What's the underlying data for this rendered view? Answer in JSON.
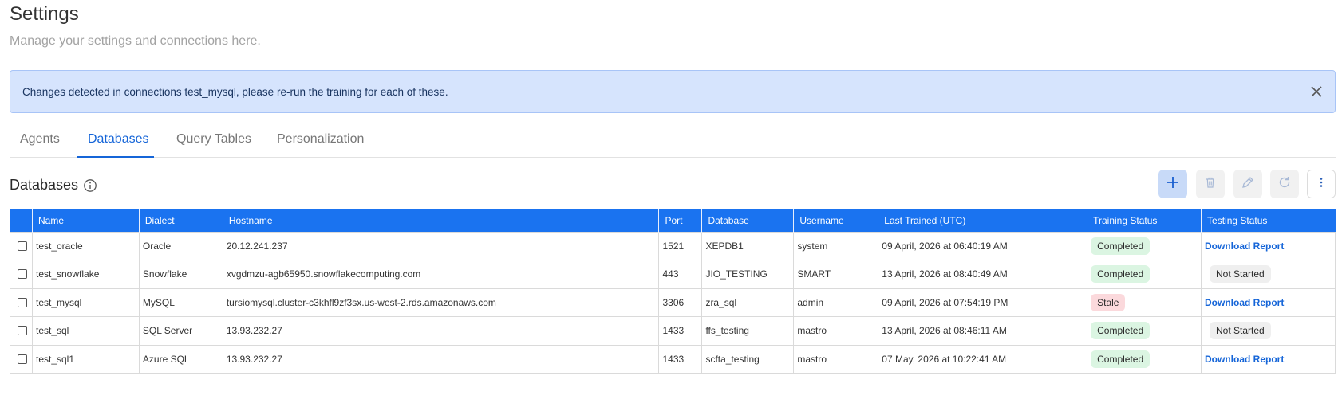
{
  "page": {
    "title": "Settings",
    "subtitle": "Manage your settings and connections here."
  },
  "alert": {
    "message": "Changes detected in connections test_mysql, please re-run the training for each of these."
  },
  "tabs": [
    {
      "label": "Agents"
    },
    {
      "label": "Databases"
    },
    {
      "label": "Query Tables"
    },
    {
      "label": "Personalization"
    }
  ],
  "section": {
    "title": "Databases"
  },
  "table": {
    "headers": [
      "Name",
      "Dialect",
      "Hostname",
      "Port",
      "Database",
      "Username",
      "Last Trained (UTC)",
      "Training Status",
      "Testing Status"
    ],
    "rows": [
      {
        "name": "test_oracle",
        "dialect": "Oracle",
        "hostname": "20.12.241.237",
        "port": "1521",
        "database": "XEPDB1",
        "username": "system",
        "last_trained": "09 April, 2026 at 06:40:19 AM",
        "training_status": "Completed",
        "testing_status": "Download Report"
      },
      {
        "name": "test_snowflake",
        "dialect": "Snowflake",
        "hostname": "xvgdmzu-agb65950.snowflakecomputing.com",
        "port": "443",
        "database": "JIO_TESTING",
        "username": "SMART",
        "last_trained": "13 April, 2026 at 08:40:49 AM",
        "training_status": "Completed",
        "testing_status": "Not Started"
      },
      {
        "name": "test_mysql",
        "dialect": "MySQL",
        "hostname": "tursiomysql.cluster-c3khfl9zf3sx.us-west-2.rds.amazonaws.com",
        "port": "3306",
        "database": "zra_sql",
        "username": "admin",
        "last_trained": "09 April, 2026 at 07:54:19 PM",
        "training_status": "Stale",
        "testing_status": "Download Report"
      },
      {
        "name": "test_sql",
        "dialect": "SQL Server",
        "hostname": "13.93.232.27",
        "port": "1433",
        "database": "ffs_testing",
        "username": "mastro",
        "last_trained": "13 April, 2026 at 08:46:11 AM",
        "training_status": "Completed",
        "testing_status": "Not Started"
      },
      {
        "name": "test_sql1",
        "dialect": "Azure SQL",
        "hostname": "13.93.232.27",
        "port": "1433",
        "database": "scfta_testing",
        "username": "mastro",
        "last_trained": "07 May, 2026 at 10:22:41 AM",
        "training_status": "Completed",
        "testing_status": "Download Report"
      }
    ]
  },
  "toolbar": {
    "icons": [
      "plus-icon",
      "trash-icon",
      "pencil-icon",
      "refresh-icon",
      "more-vertical-icon"
    ]
  },
  "colors": {
    "accent": "#1a73f0",
    "alert_bg": "#d6e4fd",
    "completed_bg": "#dbf5e2",
    "stale_bg": "#fbd9dc",
    "not_started_bg": "#efefef",
    "link": "#1565d8"
  }
}
